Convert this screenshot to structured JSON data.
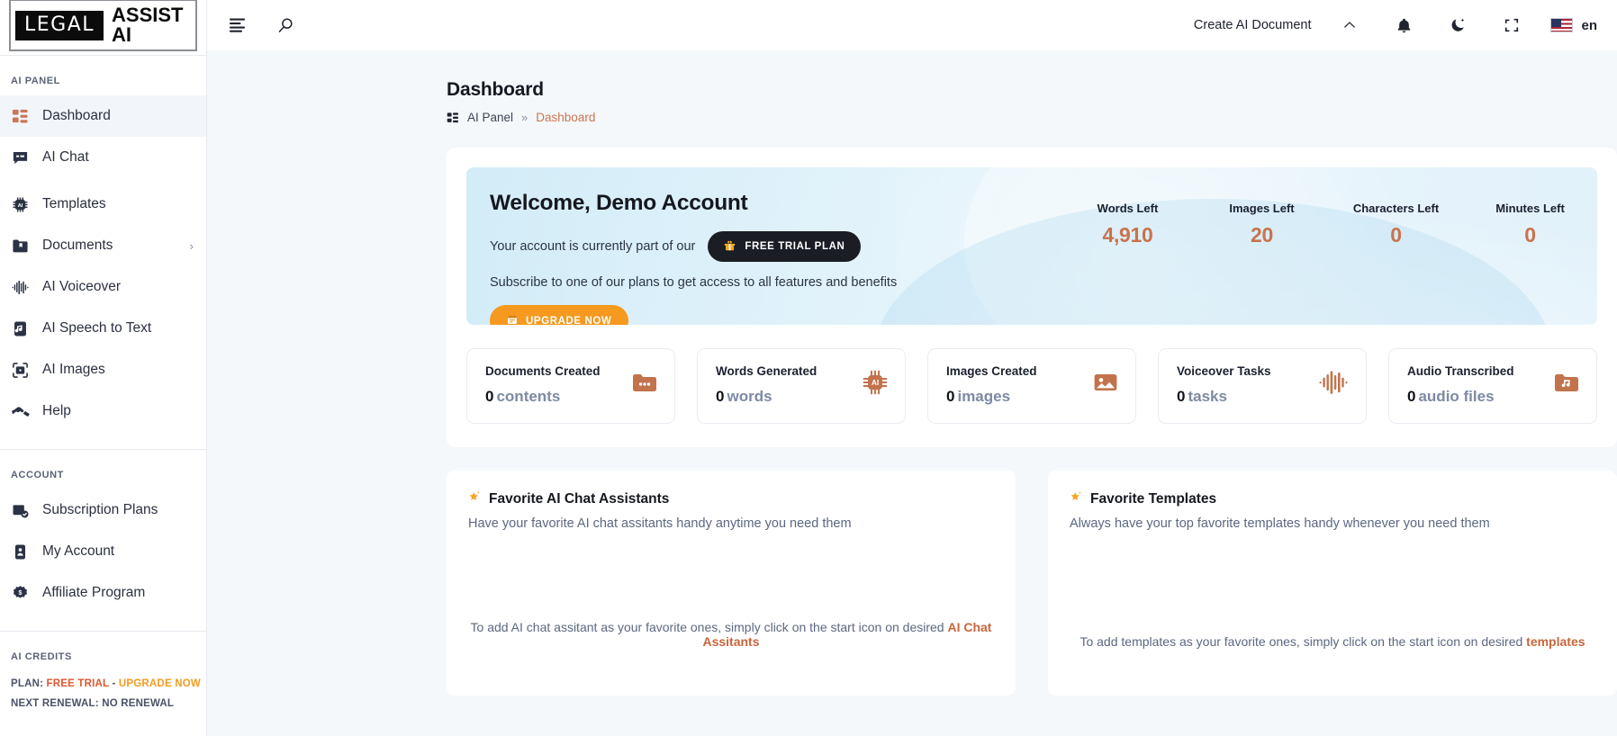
{
  "brand": {
    "logo_dark": "LEGAL",
    "logo_light": "ASSIST AI"
  },
  "sidebar": {
    "section_ai_panel": "AI PANEL",
    "section_account": "ACCOUNT",
    "section_credits": "AI CREDITS",
    "items": [
      {
        "label": "Dashboard",
        "icon": "grid-icon",
        "active": true
      },
      {
        "label": "AI Chat",
        "icon": "chat-icon",
        "active": false
      },
      {
        "label": "Templates",
        "icon": "ai-chip-icon",
        "active": false
      },
      {
        "label": "Documents",
        "icon": "folder-doc-icon",
        "active": false,
        "chevron": "›"
      },
      {
        "label": "AI Voiceover",
        "icon": "waveform-icon",
        "active": false
      },
      {
        "label": "AI Speech to Text",
        "icon": "audio-file-icon",
        "active": false
      },
      {
        "label": "AI Images",
        "icon": "camera-scan-icon",
        "active": false
      },
      {
        "label": "Help",
        "icon": "handshake-icon",
        "active": false
      }
    ],
    "account_items": [
      {
        "label": "Subscription Plans",
        "icon": "box-check-icon"
      },
      {
        "label": "My Account",
        "icon": "id-card-icon"
      },
      {
        "label": "Affiliate Program",
        "icon": "dollar-badge-icon"
      }
    ],
    "credits": {
      "plan_label": "PLAN:",
      "plan_value": "FREE TRIAL",
      "plan_dash": "-",
      "plan_upgrade": "UPGRADE NOW",
      "renewal": "NEXT RENEWAL: NO RENEWAL"
    }
  },
  "topbar": {
    "menu_icon": "hamburger-icon",
    "search_icon": "search-icon",
    "create_link": "Create AI Document",
    "chevron_icon": "chevron-up-icon",
    "bell_icon": "bell-icon",
    "theme_icon": "moon-icon",
    "fullscreen_icon": "fullscreen-icon",
    "flag_icon": "us-flag-icon",
    "lang": "en"
  },
  "page": {
    "title": "Dashboard",
    "breadcrumb": {
      "root_icon": "grid-icon",
      "root": "AI Panel",
      "sep": "»",
      "current": "Dashboard"
    }
  },
  "banner": {
    "welcome": "Welcome, Demo Account",
    "line1": "Your account is currently part of our",
    "plan_pill": "FREE TRIAL PLAN",
    "plan_pill_icon": "gift-icon",
    "line2": "Subscribe to one of our plans to get access to all features and benefits",
    "upgrade_button": "UPGRADE NOW",
    "upgrade_icon": "calendar-icon",
    "stats": [
      {
        "label": "Words Left",
        "value": "4,910"
      },
      {
        "label": "Images Left",
        "value": "20"
      },
      {
        "label": "Characters Left",
        "value": "0"
      },
      {
        "label": "Minutes Left",
        "value": "0"
      }
    ]
  },
  "cards": [
    {
      "title": "Documents Created",
      "count": "0",
      "unit": "contents",
      "icon": "folder-dots-icon"
    },
    {
      "title": "Words Generated",
      "count": "0",
      "unit": "words",
      "icon": "ai-chip-icon"
    },
    {
      "title": "Images Created",
      "count": "0",
      "unit": "images",
      "icon": "image-icon"
    },
    {
      "title": "Voiceover Tasks",
      "count": "0",
      "unit": "tasks",
      "icon": "waveform-icon"
    },
    {
      "title": "Audio Transcribed",
      "count": "0",
      "unit": "audio files",
      "icon": "folder-music-icon"
    }
  ],
  "favorites": [
    {
      "title": "Favorite AI Chat Assistants",
      "subtitle": "Have your favorite AI chat assitants handy anytime you need them",
      "empty_prefix": "To add AI chat assitant as your favorite ones, simply click on the start icon on desired ",
      "empty_link": "AI Chat Assitants",
      "star_icon": "star-icon"
    },
    {
      "title": "Favorite Templates",
      "subtitle": "Always have your top favorite templates handy whenever you need them",
      "empty_prefix": "To add templates as your favorite ones, simply click on the start icon on desired ",
      "empty_link": "templates",
      "star_icon": "star-icon"
    }
  ],
  "colors": {
    "accent": "#c8734c",
    "orange": "#f5991f",
    "link": "#cb7550",
    "dark": "#1b1d24",
    "banner": "#d7eefa"
  }
}
